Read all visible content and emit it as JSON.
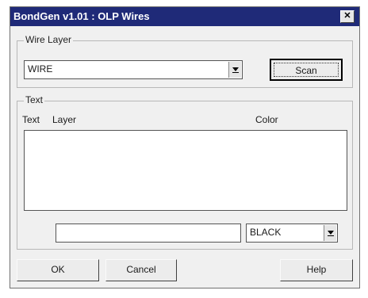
{
  "window": {
    "title": "BondGen v1.01 : OLP Wires",
    "close_glyph": "✕"
  },
  "wire_layer": {
    "legend": "Wire Layer",
    "combo_value": "WIRE",
    "scan_label": "Scan"
  },
  "text_group": {
    "legend": "Text",
    "header_text": "Text",
    "header_layer": "Layer",
    "header_color": "Color",
    "text_input_value": "",
    "color_value": "BLACK"
  },
  "buttons": {
    "ok_label": "OK",
    "cancel_label": "Cancel",
    "help_label": "Help"
  }
}
